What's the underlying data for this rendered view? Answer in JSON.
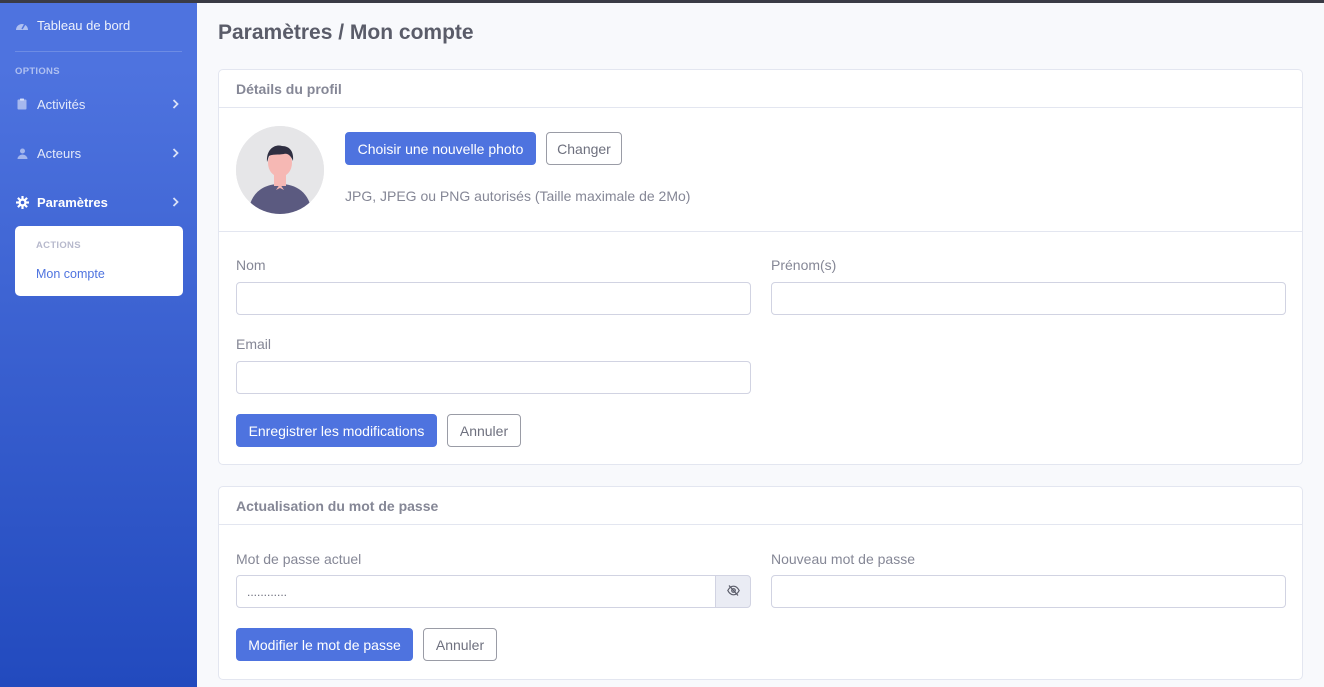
{
  "sidebar": {
    "brand_label": "Tableau de bord",
    "section_heading": "OPTIONS",
    "items": [
      {
        "label": "Activités",
        "icon": "clipboard-icon"
      },
      {
        "label": "Acteurs",
        "icon": "user-icon"
      },
      {
        "label": "Paramètres",
        "icon": "gear-icon"
      }
    ],
    "submenu": {
      "heading": "ACTIONS",
      "item": "Mon compte"
    }
  },
  "page": {
    "title_prefix": "Paramètres / ",
    "title_strong": "Mon compte"
  },
  "profile_card": {
    "header": "Détails du profil",
    "choose_photo_label": "Choisir une nouvelle photo",
    "change_label": "Changer",
    "photo_hint": "JPG, JPEG ou PNG autorisés (Taille maximale de 2Mo)",
    "nom_label": "Nom",
    "nom_value": "",
    "prenom_label": "Prénom(s)",
    "prenom_value": "",
    "email_label": "Email",
    "email_value": "",
    "save_label": "Enregistrer les modifications",
    "cancel_label": "Annuler"
  },
  "password_card": {
    "header": "Actualisation du mot de passe",
    "current_label": "Mot de passe actuel",
    "current_value": "............",
    "new_label": "Nouveau mot de passe",
    "new_value": "",
    "submit_label": "Modifier le mot de passe",
    "cancel_label": "Annuler"
  },
  "colors": {
    "primary": "#4e73df",
    "sidebar_bottom": "#224abe",
    "background": "#f8f9fc"
  }
}
